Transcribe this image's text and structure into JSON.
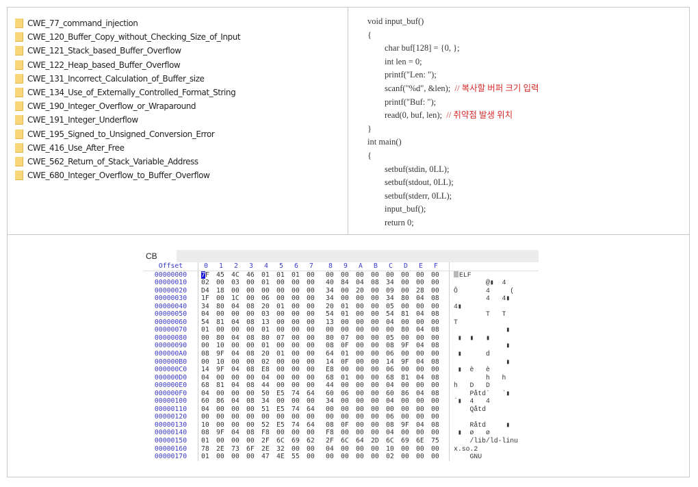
{
  "folders": [
    "CWE_77_command_injection",
    "CWE_120_Buffer_Copy_without_Checking_Size_of_Input",
    "CWE_121_Stack_based_Buffer_Overflow",
    "CWE_122_Heap_based_Buffer_Overflow",
    "CWE_131_Incorrect_Calculation_of_Buffer_size",
    "CWE_134_Use_of_Externally_Controlled_Format_String",
    "CWE_190_Integer_Overflow_or_Wraparound",
    "CWE_191_Integer_Underflow",
    "CWE_195_Signed_to_Unsigned_Conversion_Error",
    "CWE_416_Use_After_Free",
    "CWE_562_Return_of_Stack_Variable_Address",
    "CWE_680_Integer_Overflow_to_Buffer_Overflow"
  ],
  "code": [
    {
      "text": "void input_buf()",
      "indent": false,
      "comment": ""
    },
    {
      "text": "{",
      "indent": false,
      "comment": ""
    },
    {
      "text": "char buf[128] = {0, };",
      "indent": true,
      "comment": ""
    },
    {
      "text": "int len = 0;",
      "indent": true,
      "comment": ""
    },
    {
      "text": "printf(\"Len: \");",
      "indent": true,
      "comment": ""
    },
    {
      "text": "scanf(\"%d\", &len);",
      "indent": true,
      "comment": "// 복사할 버퍼 크기 입력"
    },
    {
      "text": "printf(\"Buf: \");",
      "indent": true,
      "comment": ""
    },
    {
      "text": "read(0, buf, len);",
      "indent": true,
      "comment": "// 취약점 발생 위치"
    },
    {
      "text": "}",
      "indent": false,
      "comment": ""
    },
    {
      "text": "int main()",
      "indent": false,
      "comment": ""
    },
    {
      "text": "{",
      "indent": false,
      "comment": ""
    },
    {
      "text": "setbuf(stdin, 0LL);",
      "indent": true,
      "comment": ""
    },
    {
      "text": "setbuf(stdout, 0LL);",
      "indent": true,
      "comment": ""
    },
    {
      "text": "setbuf(stderr, 0LL);",
      "indent": true,
      "comment": ""
    },
    {
      "text": "input_buf();",
      "indent": true,
      "comment": ""
    },
    {
      "text": "return 0;",
      "indent": true,
      "comment": ""
    }
  ],
  "hex_editor": {
    "tab_label": "CB",
    "offset_header": "Offset",
    "column_headers": [
      "0",
      "1",
      "2",
      "3",
      "4",
      "5",
      "6",
      "7",
      "8",
      "9",
      "A",
      "B",
      "C",
      "D",
      "E",
      "F"
    ],
    "selected_byte": "7F",
    "rows": [
      {
        "offset": "00000000",
        "bytes": [
          "7F",
          "45",
          "4C",
          "46",
          "01",
          "01",
          "01",
          "00",
          "00",
          "00",
          "00",
          "00",
          "00",
          "00",
          "00",
          "00"
        ],
        "ascii": " ELF"
      },
      {
        "offset": "00000010",
        "bytes": [
          "02",
          "00",
          "03",
          "00",
          "01",
          "00",
          "00",
          "00",
          "40",
          "84",
          "04",
          "08",
          "34",
          "00",
          "00",
          "00"
        ],
        "ascii": "        @▮  4   "
      },
      {
        "offset": "00000020",
        "bytes": [
          "D4",
          "18",
          "00",
          "00",
          "00",
          "00",
          "00",
          "00",
          "34",
          "00",
          "20",
          "00",
          "09",
          "00",
          "28",
          "00"
        ],
        "ascii": "Ô       4     ( "
      },
      {
        "offset": "00000030",
        "bytes": [
          "1F",
          "00",
          "1C",
          "00",
          "06",
          "00",
          "00",
          "00",
          "34",
          "00",
          "00",
          "00",
          "34",
          "80",
          "04",
          "08"
        ],
        "ascii": "        4   4▮  "
      },
      {
        "offset": "00000040",
        "bytes": [
          "34",
          "80",
          "04",
          "08",
          "20",
          "01",
          "00",
          "00",
          "20",
          "01",
          "00",
          "00",
          "05",
          "00",
          "00",
          "00"
        ],
        "ascii": "4▮              "
      },
      {
        "offset": "00000050",
        "bytes": [
          "04",
          "00",
          "00",
          "00",
          "03",
          "00",
          "00",
          "00",
          "54",
          "01",
          "00",
          "00",
          "54",
          "81",
          "04",
          "08"
        ],
        "ascii": "        T   T   "
      },
      {
        "offset": "00000060",
        "bytes": [
          "54",
          "81",
          "04",
          "08",
          "13",
          "00",
          "00",
          "00",
          "13",
          "00",
          "00",
          "00",
          "04",
          "00",
          "00",
          "00"
        ],
        "ascii": "T               "
      },
      {
        "offset": "00000070",
        "bytes": [
          "01",
          "00",
          "00",
          "00",
          "01",
          "00",
          "00",
          "00",
          "00",
          "00",
          "00",
          "00",
          "00",
          "80",
          "04",
          "08"
        ],
        "ascii": "             ▮  "
      },
      {
        "offset": "00000080",
        "bytes": [
          "00",
          "80",
          "04",
          "08",
          "80",
          "07",
          "00",
          "00",
          "80",
          "07",
          "00",
          "00",
          "05",
          "00",
          "00",
          "00"
        ],
        "ascii": " ▮  ▮   ▮       "
      },
      {
        "offset": "00000090",
        "bytes": [
          "00",
          "10",
          "00",
          "00",
          "01",
          "00",
          "00",
          "00",
          "08",
          "0F",
          "00",
          "00",
          "08",
          "9F",
          "04",
          "08"
        ],
        "ascii": "             ▮  "
      },
      {
        "offset": "000000A0",
        "bytes": [
          "08",
          "9F",
          "04",
          "08",
          "20",
          "01",
          "00",
          "00",
          "64",
          "01",
          "00",
          "00",
          "06",
          "00",
          "00",
          "00"
        ],
        "ascii": " ▮      d       "
      },
      {
        "offset": "000000B0",
        "bytes": [
          "00",
          "10",
          "00",
          "00",
          "02",
          "00",
          "00",
          "00",
          "14",
          "0F",
          "00",
          "00",
          "14",
          "9F",
          "04",
          "08"
        ],
        "ascii": "             ▮  "
      },
      {
        "offset": "000000C0",
        "bytes": [
          "14",
          "9F",
          "04",
          "08",
          "E8",
          "00",
          "00",
          "00",
          "E8",
          "00",
          "00",
          "00",
          "06",
          "00",
          "00",
          "00"
        ],
        "ascii": " ▮  è   è       "
      },
      {
        "offset": "000000D0",
        "bytes": [
          "04",
          "00",
          "00",
          "00",
          "04",
          "00",
          "00",
          "00",
          "68",
          "01",
          "00",
          "00",
          "68",
          "81",
          "04",
          "08"
        ],
        "ascii": "        h   h   "
      },
      {
        "offset": "000000E0",
        "bytes": [
          "68",
          "81",
          "04",
          "08",
          "44",
          "00",
          "00",
          "00",
          "44",
          "00",
          "00",
          "00",
          "04",
          "00",
          "00",
          "00"
        ],
        "ascii": "h   D   D       "
      },
      {
        "offset": "000000F0",
        "bytes": [
          "04",
          "00",
          "00",
          "00",
          "50",
          "E5",
          "74",
          "64",
          "60",
          "06",
          "00",
          "00",
          "60",
          "86",
          "04",
          "08"
        ],
        "ascii": "    Påtd`   `▮  "
      },
      {
        "offset": "00000100",
        "bytes": [
          "60",
          "86",
          "04",
          "08",
          "34",
          "00",
          "00",
          "00",
          "34",
          "00",
          "00",
          "00",
          "04",
          "00",
          "00",
          "00"
        ],
        "ascii": "`▮  4   4       "
      },
      {
        "offset": "00000110",
        "bytes": [
          "04",
          "00",
          "00",
          "00",
          "51",
          "E5",
          "74",
          "64",
          "00",
          "00",
          "00",
          "00",
          "00",
          "00",
          "00",
          "00"
        ],
        "ascii": "    Qåtd        "
      },
      {
        "offset": "00000120",
        "bytes": [
          "00",
          "00",
          "00",
          "00",
          "00",
          "00",
          "00",
          "00",
          "00",
          "00",
          "00",
          "00",
          "06",
          "00",
          "00",
          "00"
        ],
        "ascii": "                "
      },
      {
        "offset": "00000130",
        "bytes": [
          "10",
          "00",
          "00",
          "00",
          "52",
          "E5",
          "74",
          "64",
          "08",
          "0F",
          "00",
          "00",
          "08",
          "9F",
          "04",
          "08"
        ],
        "ascii": "    Råtd     ▮  "
      },
      {
        "offset": "00000140",
        "bytes": [
          "08",
          "9F",
          "04",
          "08",
          "F8",
          "00",
          "00",
          "00",
          "F8",
          "00",
          "00",
          "00",
          "04",
          "00",
          "00",
          "00"
        ],
        "ascii": " ▮  ø   ø       "
      },
      {
        "offset": "00000150",
        "bytes": [
          "01",
          "00",
          "00",
          "00",
          "2F",
          "6C",
          "69",
          "62",
          "2F",
          "6C",
          "64",
          "2D",
          "6C",
          "69",
          "6E",
          "75"
        ],
        "ascii": "    /lib/ld-linu"
      },
      {
        "offset": "00000160",
        "bytes": [
          "78",
          "2E",
          "73",
          "6F",
          "2E",
          "32",
          "00",
          "00",
          "04",
          "00",
          "00",
          "00",
          "10",
          "00",
          "00",
          "00"
        ],
        "ascii": "x.so.2          "
      },
      {
        "offset": "00000170",
        "bytes": [
          "01",
          "00",
          "00",
          "00",
          "47",
          "4E",
          "55",
          "00",
          "00",
          "00",
          "00",
          "00",
          "02",
          "00",
          "00",
          "00"
        ],
        "ascii": "    GNU         "
      }
    ]
  }
}
